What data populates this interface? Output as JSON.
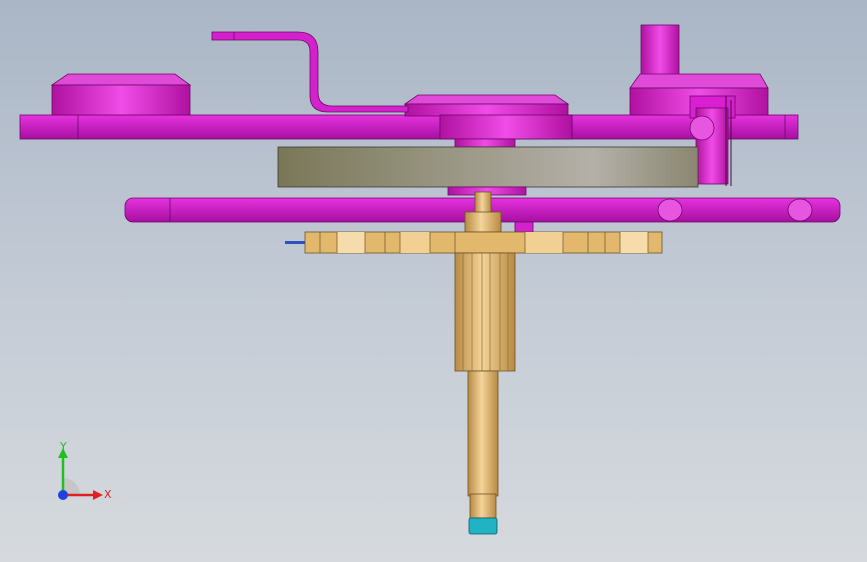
{
  "viewport": {
    "background_top": "#aab6c6",
    "background_bottom": "#d6dade"
  },
  "colors": {
    "magenta_part": "#d719d0",
    "magenta_dark": "#a0109a",
    "gray_disc": "#9e9a86",
    "gold_gear": "#e6bf78",
    "gold_dark": "#b8904c",
    "cyan_tip": "#1fb3c4"
  },
  "triad": {
    "x_label": "X",
    "y_label": "Y",
    "x_color": "#e02020",
    "y_color": "#20c020",
    "z_color": "#2040e0"
  }
}
